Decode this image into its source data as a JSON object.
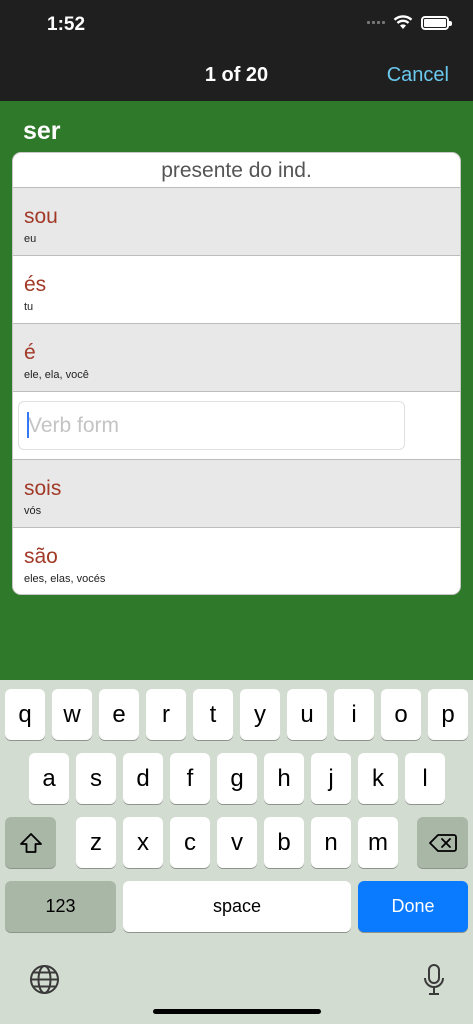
{
  "status": {
    "time": "1:52"
  },
  "nav": {
    "title": "1 of 20",
    "cancel": "Cancel"
  },
  "verb": "ser",
  "card": {
    "tense": "presente do ind.",
    "rows": [
      {
        "form": "sou",
        "pronoun": "eu"
      },
      {
        "form": "és",
        "pronoun": "tu"
      },
      {
        "form": "é",
        "pronoun": "ele, ela, você"
      },
      {
        "form": "sois",
        "pronoun": "vós"
      },
      {
        "form": "são",
        "pronoun": "eles, elas, vocés"
      }
    ],
    "input": {
      "value": "",
      "placeholder": "Verb form"
    }
  },
  "keyboard": {
    "row1": [
      "q",
      "w",
      "e",
      "r",
      "t",
      "y",
      "u",
      "i",
      "o",
      "p"
    ],
    "row2": [
      "a",
      "s",
      "d",
      "f",
      "g",
      "h",
      "j",
      "k",
      "l"
    ],
    "row3": [
      "z",
      "x",
      "c",
      "v",
      "b",
      "n",
      "m"
    ],
    "numbers": "123",
    "space": "space",
    "done": "Done"
  },
  "icons": [
    "wifi-icon",
    "battery-icon",
    "shift-icon",
    "backspace-icon",
    "globe-icon",
    "microphone-icon"
  ],
  "colors": {
    "accent_green": "#2f7a2a",
    "form_red": "#a23a28",
    "cancel_blue": "#6bc8ef",
    "done_blue": "#0a7aff"
  }
}
